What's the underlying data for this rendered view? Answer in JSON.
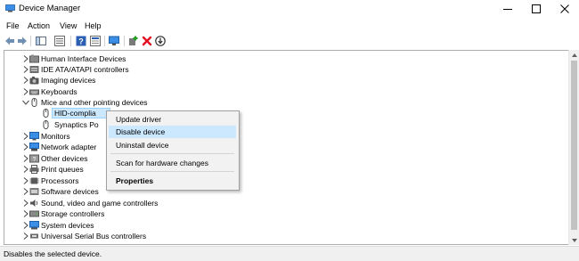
{
  "window": {
    "title": "Device Manager"
  },
  "menu": {
    "file": "File",
    "action": "Action",
    "view": "View",
    "help": "Help"
  },
  "tree": {
    "items": [
      {
        "label": "Human Interface Devices",
        "icon": "hid-icon"
      },
      {
        "label": "IDE ATA/ATAPI controllers",
        "icon": "ide-icon"
      },
      {
        "label": "Imaging devices",
        "icon": "camera-icon"
      },
      {
        "label": "Keyboards",
        "icon": "keyboard-icon"
      },
      {
        "label": "Mice and other pointing devices",
        "icon": "mouse-icon",
        "expanded": true
      },
      {
        "label": "HID-complia",
        "icon": "mouse-icon",
        "selected": true
      },
      {
        "label": "Synaptics Po",
        "icon": "mouse-icon"
      },
      {
        "label": "Monitors",
        "icon": "monitor-icon"
      },
      {
        "label": "Network adapter",
        "icon": "network-icon"
      },
      {
        "label": "Other devices",
        "icon": "unknown-device-icon"
      },
      {
        "label": "Print queues",
        "icon": "printer-icon"
      },
      {
        "label": "Processors",
        "icon": "processor-icon"
      },
      {
        "label": "Software devices",
        "icon": "software-device-icon"
      },
      {
        "label": "Sound, video and game controllers",
        "icon": "speaker-icon"
      },
      {
        "label": "Storage controllers",
        "icon": "storage-icon"
      },
      {
        "label": "System devices",
        "icon": "system-icon"
      },
      {
        "label": "Universal Serial Bus controllers",
        "icon": "usb-icon"
      }
    ]
  },
  "context_menu": {
    "update_driver": "Update driver",
    "disable_device": "Disable device",
    "uninstall_device": "Uninstall device",
    "scan_hardware": "Scan for hardware changes",
    "properties": "Properties"
  },
  "status": {
    "text": "Disables the selected device."
  },
  "colors": {
    "selection": "#cce8ff",
    "menu_background": "#f2f2f2",
    "remove_red": "#e81123"
  }
}
